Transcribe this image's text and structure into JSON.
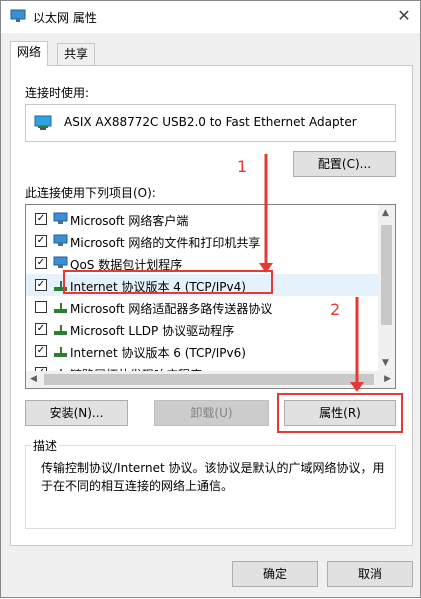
{
  "window": {
    "title": "以太网 属性"
  },
  "tabs": [
    {
      "label": "网络"
    },
    {
      "label": "共享"
    }
  ],
  "connect_using": {
    "label": "连接时使用:",
    "adapter": "ASIX AX88772C USB2.0 to Fast Ethernet Adapter",
    "configure_label": "配置(C)..."
  },
  "items_label": "此连接使用下列项目(O):",
  "items": [
    {
      "label": "Microsoft 网络客户端",
      "checked": true,
      "icon": "network-client-icon"
    },
    {
      "label": "Microsoft 网络的文件和打印机共享",
      "checked": true,
      "icon": "file-share-icon"
    },
    {
      "label": "QoS 数据包计划程序",
      "checked": true,
      "icon": "qos-icon"
    },
    {
      "label": "Internet 协议版本 4 (TCP/IPv4)",
      "checked": true,
      "icon": "protocol-icon"
    },
    {
      "label": "Microsoft 网络适配器多路传送器协议",
      "checked": false,
      "icon": "protocol-icon"
    },
    {
      "label": "Microsoft LLDP 协议驱动程序",
      "checked": true,
      "icon": "protocol-icon"
    },
    {
      "label": "Internet 协议版本 6 (TCP/IPv6)",
      "checked": true,
      "icon": "protocol-icon"
    },
    {
      "label": "链路层拓扑发现响应程序",
      "checked": true,
      "icon": "protocol-icon"
    }
  ],
  "buttons": {
    "install": "安装(N)...",
    "uninstall": "卸载(U)",
    "properties": "属性(R)",
    "ok": "确定",
    "cancel": "取消"
  },
  "description": {
    "title": "描述",
    "text": "传输控制协议/Internet 协议。该协议是默认的广域网络协议，用于在不同的相互连接的网络上通信。"
  },
  "annotations": {
    "step1": "1",
    "step2": "2",
    "color": "#e53935"
  }
}
